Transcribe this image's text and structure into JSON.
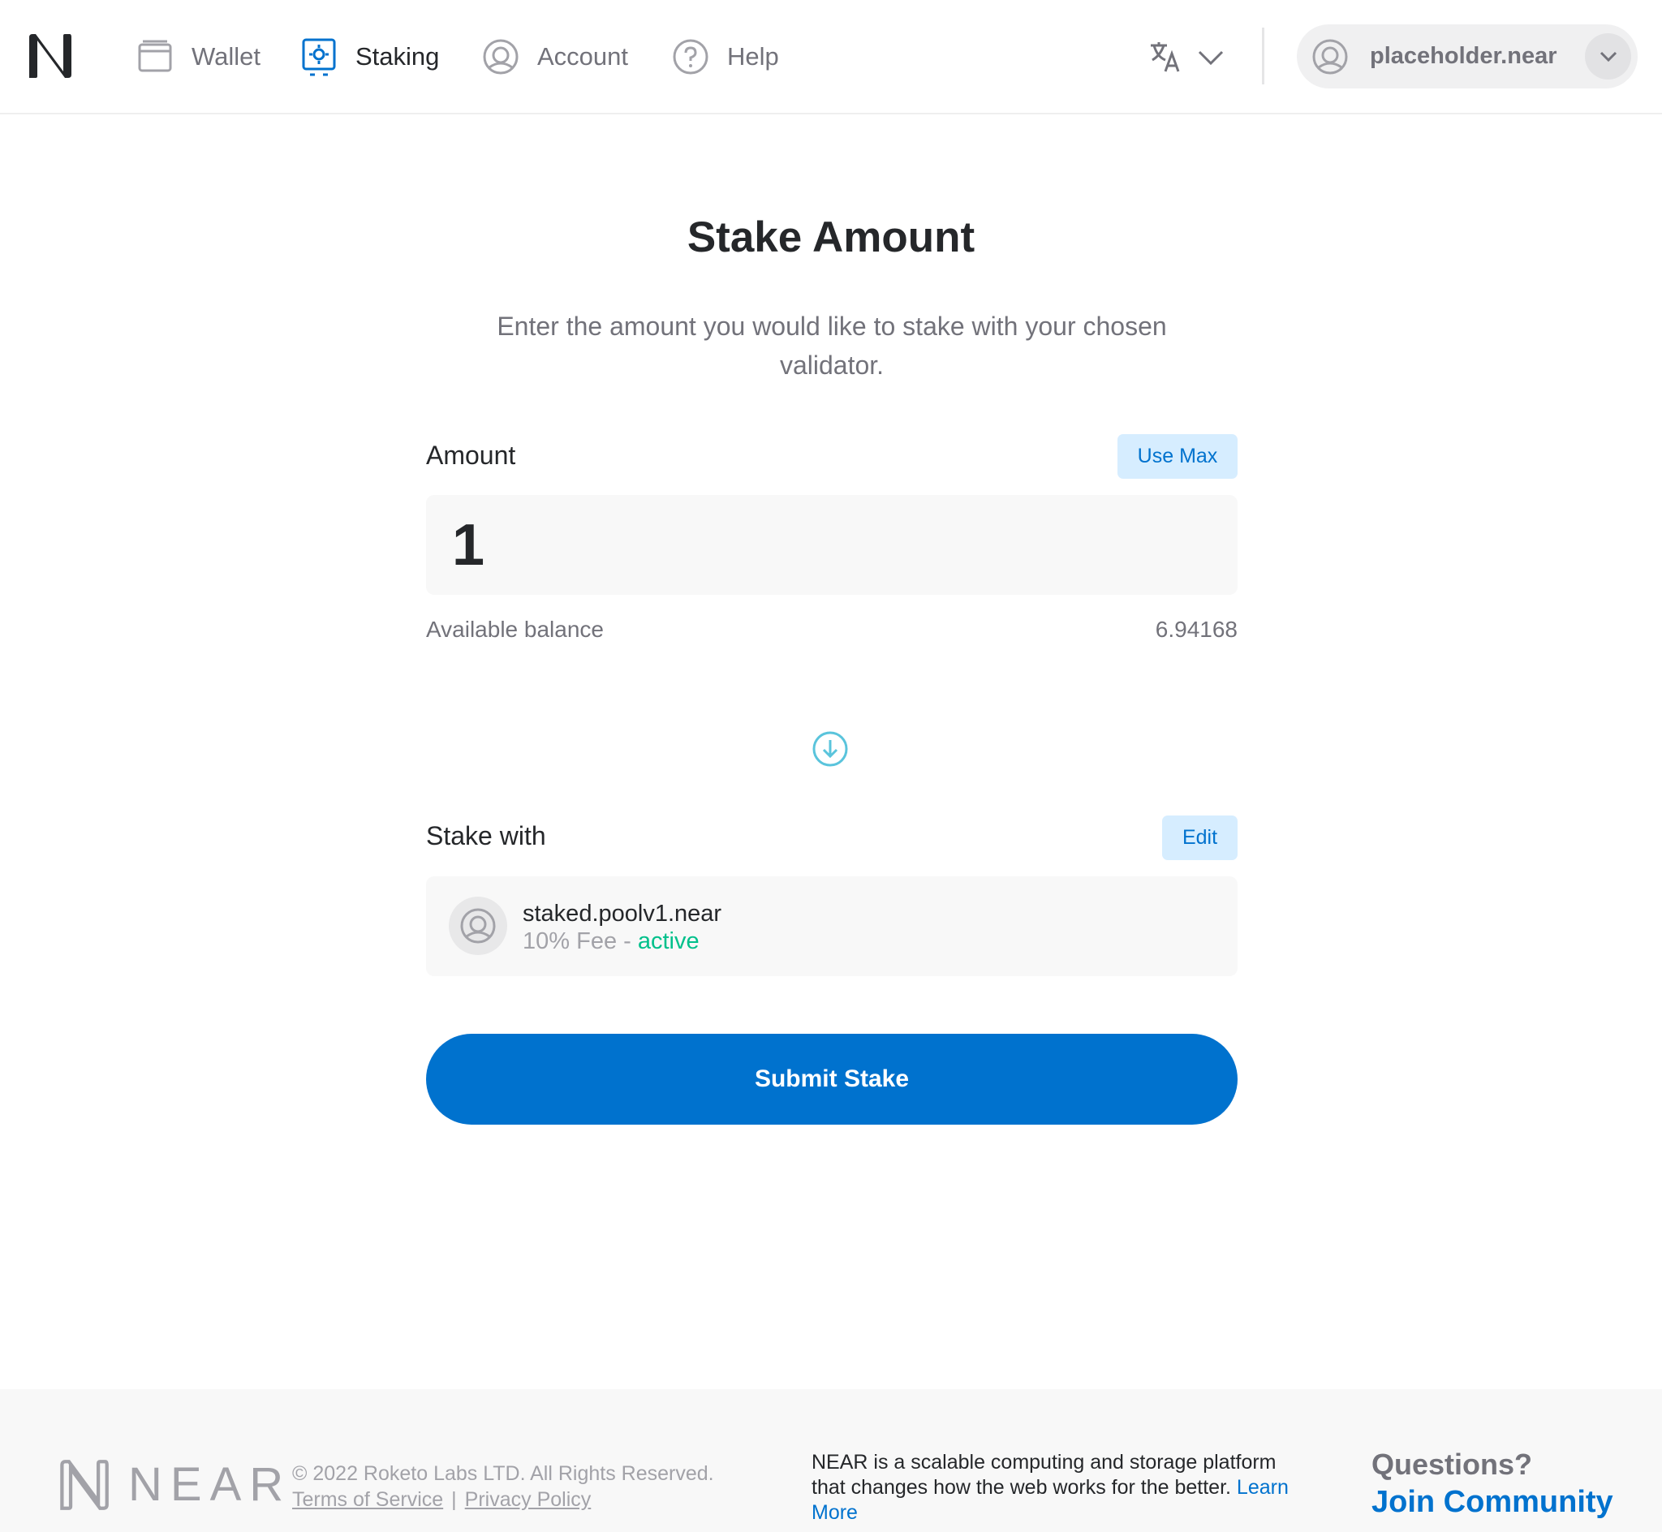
{
  "header": {
    "nav": [
      {
        "label": "Wallet",
        "icon": "wallet-icon"
      },
      {
        "label": "Staking",
        "icon": "staking-icon",
        "active": true
      },
      {
        "label": "Account",
        "icon": "account-icon"
      },
      {
        "label": "Help",
        "icon": "help-icon"
      }
    ],
    "language_icon": "translate-icon",
    "account_name": "placeholder.near"
  },
  "main": {
    "title": "Stake Amount",
    "description": "Enter the amount you would like to stake with your chosen validator.",
    "amount_label": "Amount",
    "use_max_label": "Use Max",
    "amount_value": "1",
    "available_balance_label": "Available balance",
    "available_balance_value": "6.94168",
    "stake_with_label": "Stake with",
    "edit_label": "Edit",
    "validator": {
      "name": "staked.poolv1.near",
      "fee": "10% Fee",
      "separator": " - ",
      "status": "active"
    },
    "submit_label": "Submit Stake"
  },
  "footer": {
    "wordmark": "NEAR",
    "copyright": "© 2022 Roketo Labs LTD. All Rights Reserved.",
    "terms": "Terms of Service",
    "privacy": "Privacy Policy",
    "divider": "|",
    "about": "NEAR is a scalable computing and storage platform that changes how the web works for the better.",
    "learn_more": "Learn More",
    "questions": "Questions?",
    "join": "Join Community"
  },
  "colors": {
    "brand_blue": "#0072ce",
    "active_green": "#00c08b",
    "muted_text": "#72727a",
    "light_blue_button": "#d6edff"
  }
}
